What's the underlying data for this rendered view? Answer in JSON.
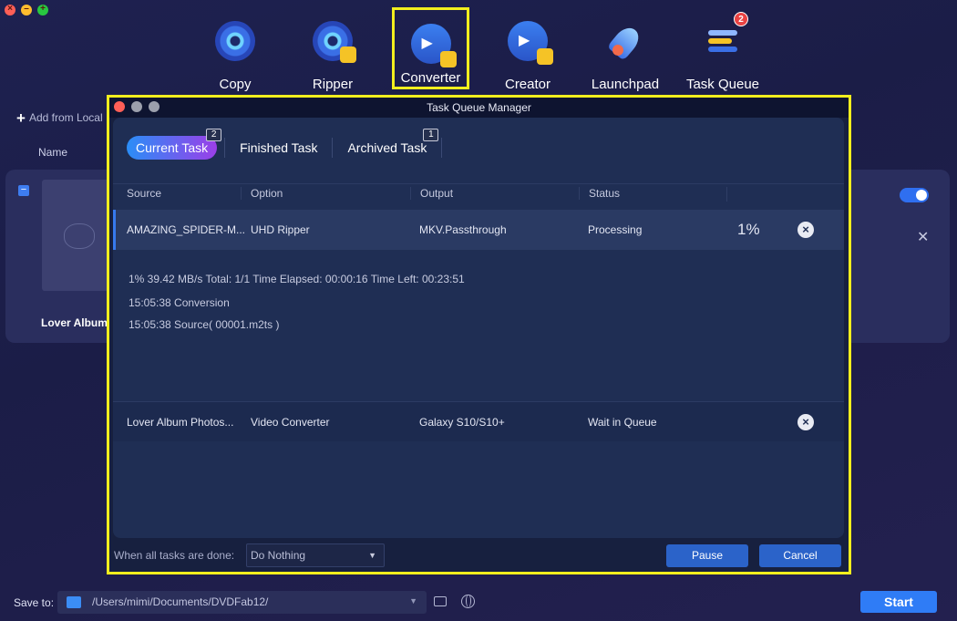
{
  "app": {
    "nav": [
      {
        "label": "Copy",
        "icon": "copy-disc-icon"
      },
      {
        "label": "Ripper",
        "icon": "ripper-disc-icon"
      },
      {
        "label": "Converter",
        "icon": "converter-film-icon"
      },
      {
        "label": "Creator",
        "icon": "creator-film-icon"
      },
      {
        "label": "Launchpad",
        "icon": "rocket-icon"
      },
      {
        "label": "Task Queue",
        "icon": "task-queue-icon"
      }
    ],
    "task_queue_badge": "2",
    "add_from_local": "Add from Local",
    "column_name": "Name",
    "background_item": "Lover Album",
    "save_to_label": "Save to:",
    "save_path": "/Users/mimi/Documents/DVDFab12/",
    "start_label": "Start"
  },
  "modal": {
    "title": "Task Queue Manager",
    "tabs": [
      {
        "label": "Current Task",
        "badge": "2",
        "active": true
      },
      {
        "label": "Finished Task",
        "badge": "",
        "active": false
      },
      {
        "label": "Archived Task",
        "badge": "1",
        "active": false
      }
    ],
    "columns": [
      "Source",
      "Option",
      "Output",
      "Status"
    ],
    "rows": [
      {
        "source": "AMAZING_SPIDER-M...",
        "option": "UHD Ripper",
        "output": "MKV.Passthrough",
        "status": "Processing",
        "progress": "1%"
      },
      {
        "source": "Lover Album Photos...",
        "option": "Video Converter",
        "output": "Galaxy S10/S10+",
        "status": "Wait in Queue",
        "progress": ""
      }
    ],
    "details": {
      "progress_line": "1%  39.42 MB/s   Total: 1/1   Time Elapsed: 00:00:16   Time Left: 00:23:51",
      "log": [
        "15:05:38  Conversion",
        "15:05:38  Source( 00001.m2ts )"
      ]
    },
    "footer": {
      "when_done_label": "When all tasks are done:",
      "when_done_value": "Do Nothing",
      "pause_label": "Pause",
      "cancel_label": "Cancel"
    }
  },
  "colors": {
    "highlight": "#f2ee1e",
    "accent": "#2f7cf6",
    "tab_gradient_start": "#2a8ef7",
    "tab_gradient_end": "#9b3fe8"
  }
}
